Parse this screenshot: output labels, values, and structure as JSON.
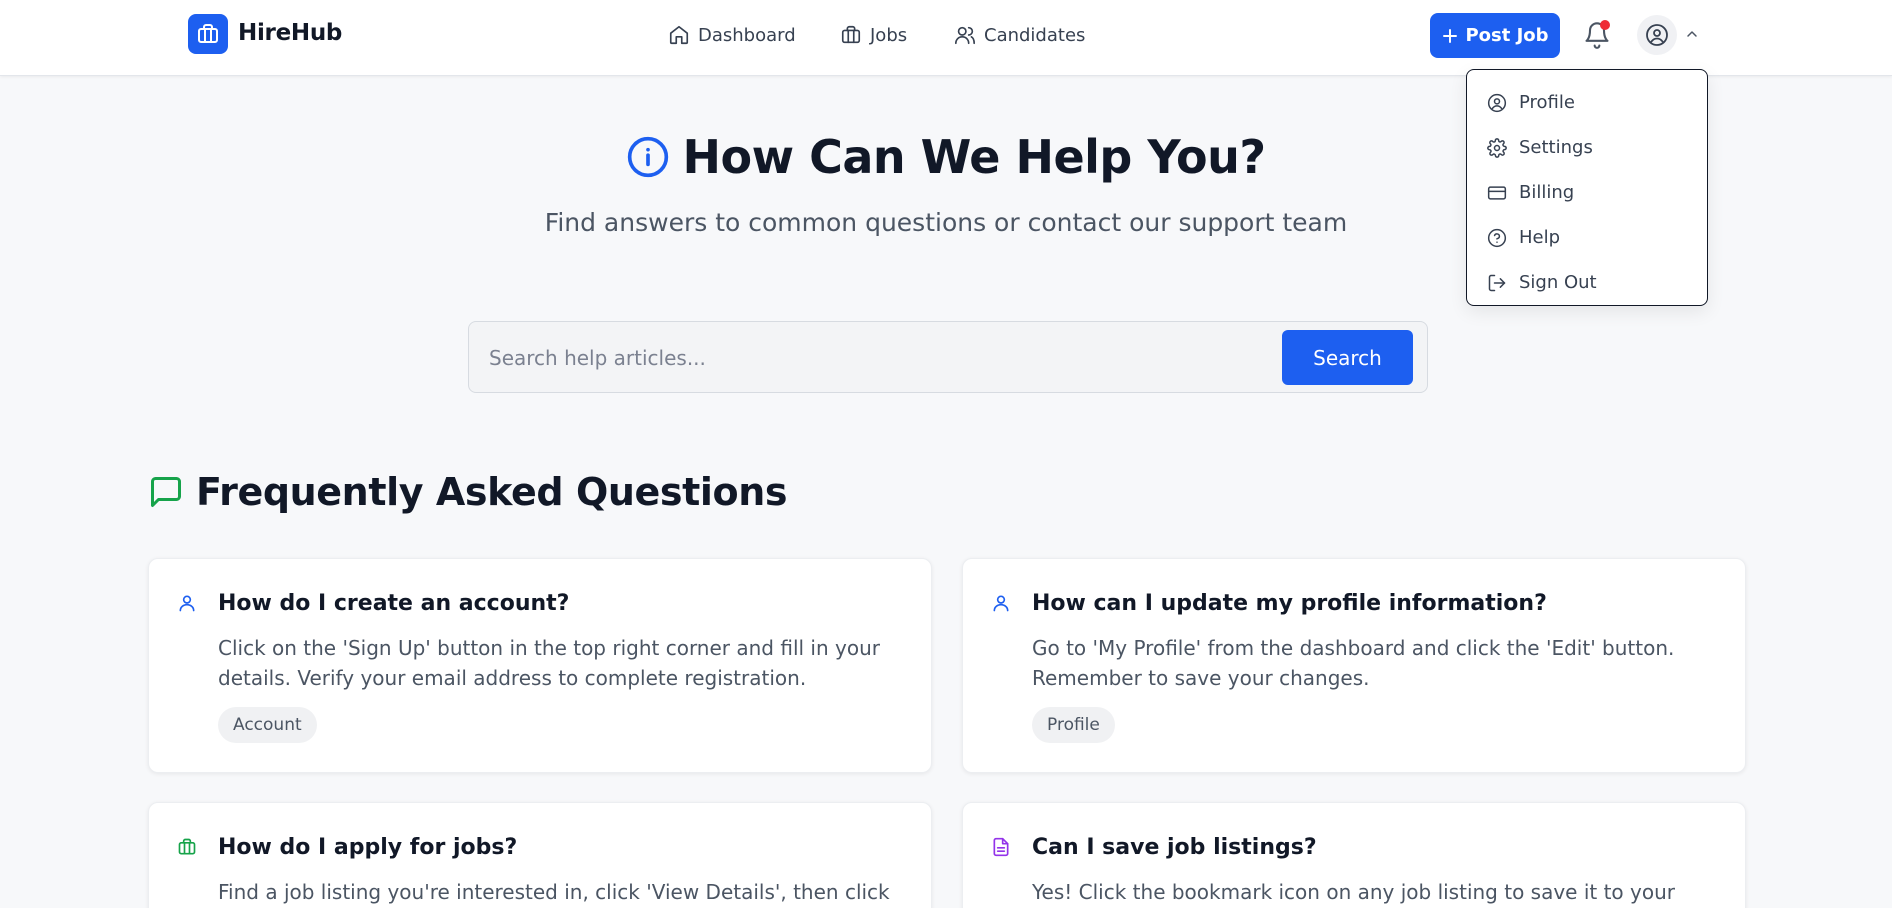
{
  "app": {
    "name": "HireHub",
    "brand_color": "#1d5ff0"
  },
  "nav": {
    "items": [
      {
        "label": "Dashboard",
        "icon": "home-icon"
      },
      {
        "label": "Jobs",
        "icon": "briefcase-icon"
      },
      {
        "label": "Candidates",
        "icon": "users-icon"
      }
    ]
  },
  "header": {
    "post_job_label": "Post Job",
    "notification_badge": true
  },
  "user_menu": {
    "items": [
      {
        "label": "Profile",
        "icon": "user-circle-icon"
      },
      {
        "label": "Settings",
        "icon": "gear-icon"
      },
      {
        "label": "Billing",
        "icon": "credit-card-icon"
      },
      {
        "label": "Help",
        "icon": "help-circle-icon"
      },
      {
        "label": "Sign Out",
        "icon": "log-out-icon"
      }
    ]
  },
  "hero": {
    "title": "How Can We Help You?",
    "subtitle": "Find answers to common questions or contact our support team"
  },
  "search": {
    "placeholder": "Search help articles...",
    "value": "",
    "button_label": "Search"
  },
  "faq": {
    "heading": "Frequently Asked Questions",
    "items": [
      {
        "question": "How do I create an account?",
        "answer": "Click on the 'Sign Up' button in the top right corner and fill in your details. Verify your email address to complete registration.",
        "tag": "Account",
        "icon": "user-icon",
        "icon_color": "#1d5ff0"
      },
      {
        "question": "How can I update my profile information?",
        "answer": "Go to 'My Profile' from the dashboard and click the 'Edit' button. Remember to save your changes.",
        "tag": "Profile",
        "icon": "user-icon",
        "icon_color": "#1d5ff0"
      },
      {
        "question": "How do I apply for jobs?",
        "answer": "Find a job listing you're interested in, click 'View Details', then click",
        "icon": "briefcase-icon",
        "icon_color": "#16a34a"
      },
      {
        "question": "Can I save job listings?",
        "answer": "Yes! Click the bookmark icon on any job listing to save it to your",
        "icon": "document-icon",
        "icon_color": "#9333ea"
      }
    ]
  }
}
